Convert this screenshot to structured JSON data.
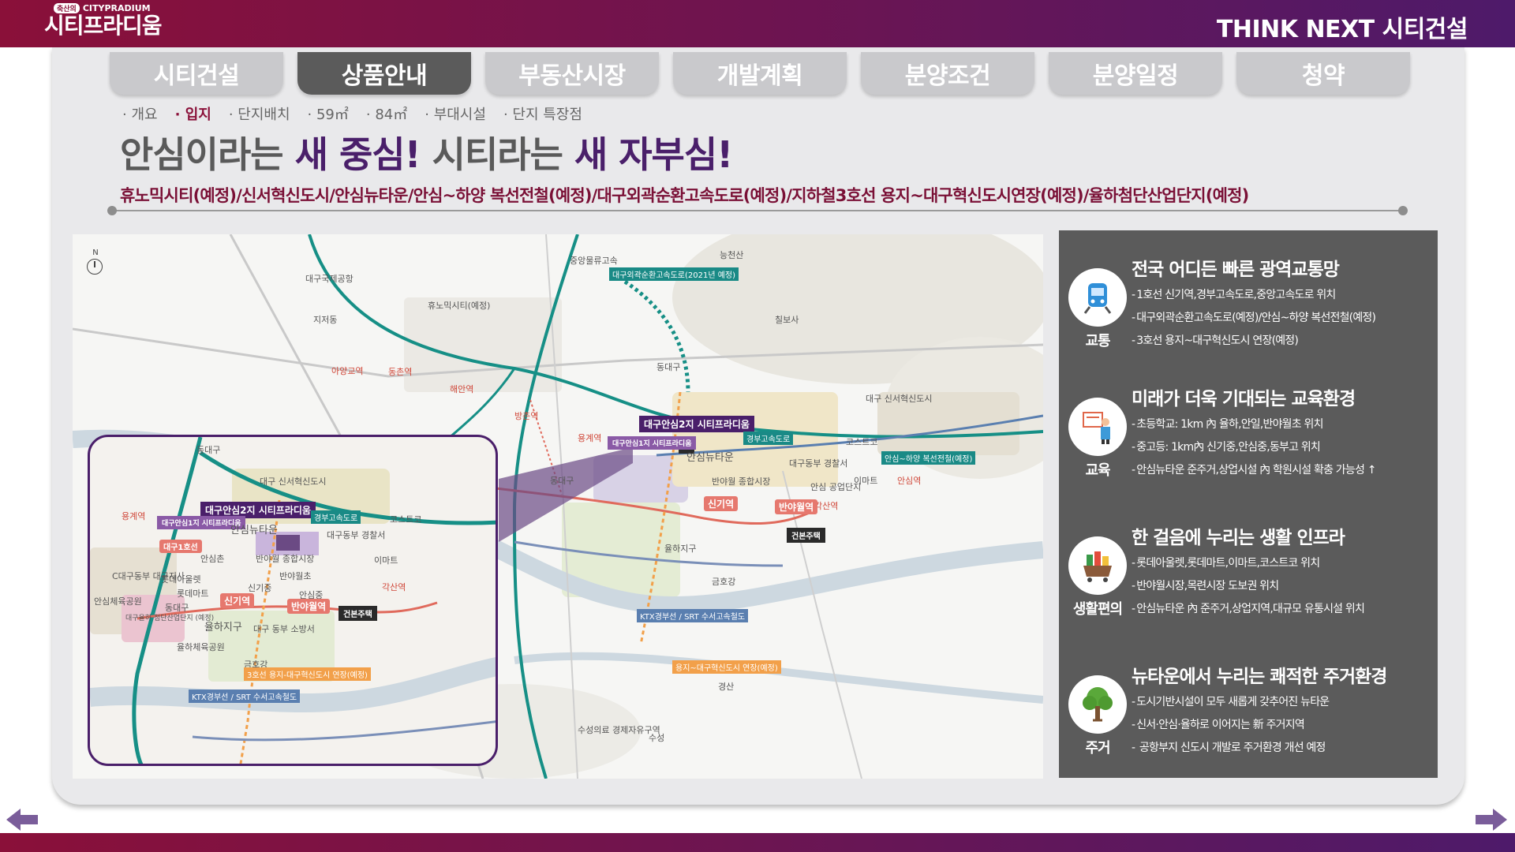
{
  "header": {
    "brand_tag": "축산의",
    "brand_en": "CITYPRADIUM",
    "brand_ko": "시티프라디움",
    "slogan": "THINK NEXT 시티건설"
  },
  "tabs": [
    {
      "label": "시티건설",
      "active": false
    },
    {
      "label": "상품안내",
      "active": true
    },
    {
      "label": "부동산시장",
      "active": false
    },
    {
      "label": "개발계획",
      "active": false
    },
    {
      "label": "분양조건",
      "active": false
    },
    {
      "label": "분양일정",
      "active": false
    },
    {
      "label": "청약",
      "active": false
    }
  ],
  "subnav": [
    {
      "label": "개요",
      "active": false
    },
    {
      "label": "입지",
      "active": true
    },
    {
      "label": "단지배치",
      "active": false
    },
    {
      "label": "59㎡",
      "active": false
    },
    {
      "label": "84㎡",
      "active": false
    },
    {
      "label": "부대시설",
      "active": false
    },
    {
      "label": "단지 특장점",
      "active": false
    }
  ],
  "title": {
    "part1": "안심이라는 ",
    "hl1": "새 중심!",
    "part2": " 시티라는 ",
    "hl2": "새 자부심!"
  },
  "subtitle": "휴노믹시티(예정)/신서혁신도시/안심뉴타운/안심~하양 복선전철(예정)/대구외곽순환고속도로(예정)/지하철3호선 용지~대구혁신도시연장(예정)/율하첨단산업단지(예정)",
  "map": {
    "compass": "N",
    "labels": {
      "nongong": "중앙물류고속",
      "outer_ring": "대구외곽순환고속도로(2021년 예정)",
      "nuncheon": "능천산",
      "airport": "대구국제공항",
      "humonic": "휴노믹시티(예정)",
      "jijo": "지저동",
      "dongdaegu_ic": "동대구",
      "ayang": "아양교역",
      "dongchon": "동촌역",
      "haean": "해안역",
      "bangchon": "방촌역",
      "yongje": "용계역",
      "chilbosa": "칠보사",
      "pin_main": "대구안심2지 시티프라디움",
      "pin_sub": "대구안심1지 시티프라디움",
      "ansim_newtown": "안심뉴타운",
      "gyeongbu": "경부고속도로",
      "costco": "코스트코",
      "hayang_line": "안심~하양 복선전철(예정)",
      "innovation": "대구 신서혁신도시",
      "banya_market": "반야월 종합시장",
      "dongbu_police": "대구동부 경찰서",
      "emart": "이마트",
      "ansim_industrial": "안심 공업단지",
      "ansim_station": "안심역",
      "gaksan": "각산역",
      "banyawol": "반야월역",
      "sinki": "신기역",
      "geonbon": "건본주택",
      "yulha": "율하지구",
      "geumho": "금호강",
      "ktx": "KTX경부선 / SRT 수서고속철도",
      "line3": "용지~대구혁신도시 연장(예정)",
      "gyeongsan": "경산",
      "suseong": "수성의료 경제자유구역",
      "suseong_ic": "수성",
      "dongdaegu_jc": "동대구",
      "dalseong": "경산"
    },
    "inset": {
      "pin_main": "대구안심2지 시티프라디움",
      "pin_sub": "대구안심1지 시티프라디움",
      "ansim_newtown": "안심뉴타운",
      "dongdaegu": "동대구",
      "innovation": "대구 신서혁신도시",
      "gyeongbu": "경부고속도로",
      "costco": "코스트코",
      "dongbu_police": "대구동부 경찰서",
      "yongje": "용계역",
      "ansim_chon": "안심촌",
      "banya_market": "반야월 종합시장",
      "emart": "이마트",
      "lotte_outlet": "롯데아울렛",
      "lotte_mart": "롯데마트",
      "sinki_jung": "신기중",
      "banyawol_cho": "반야월초",
      "ansim_jung": "안심중",
      "gaksan": "각산역",
      "sinki": "신기역",
      "banyawol": "반야월역",
      "geonbon": "건본주택",
      "yulha": "율하지구",
      "yulha_park": "율하체육공원",
      "dongbu_fire": "대구 동부 소방서",
      "geumho": "금호강",
      "line3": "3호선 용지-대구혁신도시 연장(예정)",
      "ktx": "KTX경부선 / SRT 수서고속철도",
      "ansim_sports": "안심체육공원",
      "daegu_hq": "C대구동부 대구지사",
      "yulha_industrial": "대구율하 첨단산업단지 (예정)",
      "dongdaegu_ic": "동대구",
      "dongdaegu_line1": "대구1호선"
    }
  },
  "features": [
    {
      "icon": "train-icon",
      "icon_label": "교통",
      "title": "전국 어디든 빠른 광역교통망",
      "items": [
        "1호선 신기역,경부고속도로,중앙고속도로 위치",
        "대구외곽순환고속도로(예정)/안심~하양 복선전철(예정)",
        "3호선 용지~대구혁신도시 연장(예정)"
      ]
    },
    {
      "icon": "teacher-icon",
      "icon_label": "교육",
      "title": "미래가 더욱 기대되는 교육환경",
      "items": [
        "초등학교: 1km 內 율하,안일,반야월초 위치",
        "중고등: 1km內 신기중,안심중,동부고 위치",
        "안심뉴타운 준주거,상업시설 內 학원시설 확충 가능성 ↑"
      ]
    },
    {
      "icon": "shopping-cart-icon",
      "icon_label": "생활편의",
      "title": "한 걸음에 누리는 생활 인프라",
      "items": [
        "롯데아울렛,롯데마트,이마트,코스트코 위치",
        "반야월시장,목련시장 도보권 위치",
        "안심뉴타운 內 준주거,상업지역,대규모 유통시설 위치"
      ]
    },
    {
      "icon": "tree-icon",
      "icon_label": "주거",
      "title": "뉴타운에서 누리는 쾌적한 주거환경",
      "items": [
        "도시기반시설이 모두 새롭게 갖추어진 뉴타운",
        "신서·안심·율하로 이어지는 新 주거지역",
        " 공항부지 신도시 개발로 주거환경 개선 예정"
      ]
    }
  ],
  "colors": {
    "brand": "#8a1039",
    "purple": "#4a1f6a",
    "tab_active": "#5b5b5b",
    "tab": "#c9c9cc",
    "panel": "#5b5b5b"
  }
}
